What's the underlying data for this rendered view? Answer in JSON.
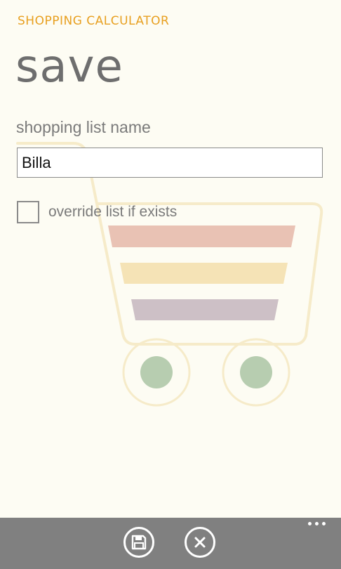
{
  "header": {
    "app_title": "SHOPPING CALCULATOR",
    "page_title": "save"
  },
  "form": {
    "name_label": "shopping list name",
    "name_value": "Billa",
    "override_label": "override list if exists",
    "override_checked": false
  },
  "app_bar": {
    "buttons": [
      {
        "icon": "save-icon"
      },
      {
        "icon": "close-icon"
      }
    ],
    "more_icon": "ellipsis-icon"
  },
  "colors": {
    "background": "#fdfcf3",
    "accent": "#e8a020",
    "app_bar": "#808080",
    "cart_stripe_red": "#e9c2b4",
    "cart_stripe_yellow": "#f5e3b6",
    "cart_stripe_purple": "#cdc0c6",
    "cart_wheel": "#b7cdb0"
  }
}
